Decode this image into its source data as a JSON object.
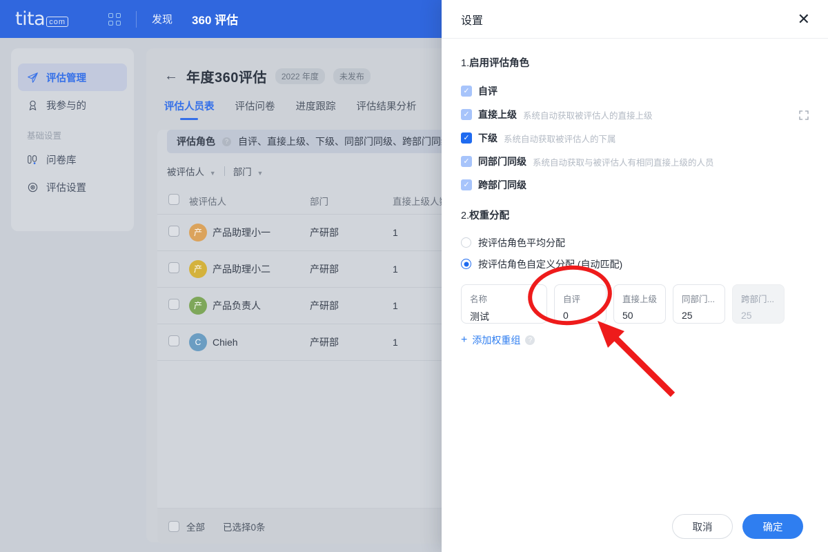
{
  "topbar": {
    "logo_text": "tita",
    "logo_badge": "com",
    "grid_icon": "apps-grid-icon",
    "nav": [
      {
        "label": "发现",
        "active": false
      },
      {
        "label": "360 评估",
        "active": true
      }
    ]
  },
  "sidebar": {
    "items": [
      {
        "label": "评估管理",
        "icon": "send-plane-icon",
        "active": true
      },
      {
        "label": "我参与的",
        "icon": "medal-icon",
        "active": false
      }
    ],
    "group_label": "基础设置",
    "group_items": [
      {
        "label": "问卷库",
        "icon": "question-bank-icon",
        "active": false
      },
      {
        "label": "评估设置",
        "icon": "target-settings-icon",
        "active": false
      }
    ]
  },
  "page": {
    "back_icon": "arrow-left-icon",
    "title": "年度360评估",
    "badges": [
      "2022 年度",
      "未发布"
    ],
    "tabs": [
      {
        "label": "评估人员表",
        "active": true
      },
      {
        "label": "评估问卷",
        "active": false
      },
      {
        "label": "进度跟踪",
        "active": false
      },
      {
        "label": "评估结果分析",
        "active": false
      }
    ],
    "role_bar": {
      "label": "评估角色",
      "help_icon": "help-circle-icon",
      "value": "自评、直接上级、下级、同部门同级、跨部门同级"
    },
    "filters": [
      {
        "label": "被评估人",
        "icon": "chevron-down-icon"
      },
      {
        "label": "部门",
        "icon": "chevron-down-icon"
      }
    ],
    "table": {
      "columns": [
        "被评估人",
        "部门",
        "直接上级人数"
      ],
      "rows": [
        {
          "name": "产品助理小一",
          "dept": "产研部",
          "managers": "1",
          "avatar_text": "产",
          "avatar_color": "#dba35c"
        },
        {
          "name": "产品助理小二",
          "dept": "产研部",
          "managers": "1",
          "avatar_text": "产",
          "avatar_color": "#d4b23c"
        },
        {
          "name": "产品负责人",
          "dept": "产研部",
          "managers": "1",
          "avatar_text": "产",
          "avatar_color": "#7ea75a"
        },
        {
          "name": "Chieh",
          "dept": "产研部",
          "managers": "1",
          "avatar_text": "C",
          "avatar_color": "#6b9dc2"
        }
      ]
    },
    "footer": {
      "select_all_label": "全部",
      "selection_text": "已选择0条"
    }
  },
  "dialog": {
    "title": "设置",
    "close_icon": "close-icon",
    "section1": {
      "title": "1.启用评估角色",
      "num": "1.",
      "heading": "启用评估角色",
      "roles": [
        {
          "label": "自评",
          "hint": "",
          "checked": true,
          "style": "soft"
        },
        {
          "label": "直接上级",
          "hint": "系统自动获取被评估人的直接上级",
          "checked": true,
          "style": "soft"
        },
        {
          "label": "下级",
          "hint": "系统自动获取被评估人的下属",
          "checked": true,
          "style": "solid"
        },
        {
          "label": "同部门同级",
          "hint": "系统自动获取与被评估人有相同直接上级的人员",
          "checked": true,
          "style": "soft"
        },
        {
          "label": "跨部门同级",
          "hint": "",
          "checked": true,
          "style": "soft"
        }
      ]
    },
    "section2": {
      "title": "2.权重分配",
      "num": "2.",
      "heading": "权重分配",
      "options": [
        {
          "label": "按评估角色平均分配",
          "selected": false
        },
        {
          "label": "按评估角色自定义分配 (自动匹配)",
          "selected": true
        }
      ],
      "expand_icon": "fullscreen-expand-icon",
      "weight_table": {
        "columns": [
          {
            "label": "名称",
            "value": "测试",
            "type": "name",
            "disabled": false
          },
          {
            "label": "自评",
            "value": "0",
            "type": "value",
            "disabled": false
          },
          {
            "label": "直接上级",
            "value": "50",
            "type": "value",
            "disabled": false
          },
          {
            "label": "同部门...",
            "value": "25",
            "type": "value",
            "disabled": false
          },
          {
            "label": "跨部门...",
            "value": "25",
            "type": "value",
            "disabled": true
          }
        ]
      },
      "add_label": "添加权重组",
      "add_icon": "plus-icon",
      "add_help_icon": "help-circle-icon"
    },
    "footer": {
      "cancel_label": "取消",
      "confirm_label": "确定"
    }
  },
  "annotations": {
    "circle_color": "#ee1b1b",
    "arrow_color": "#ee1b1b",
    "circle_target": "自评",
    "arrow_points_to": "自评 weight field"
  }
}
